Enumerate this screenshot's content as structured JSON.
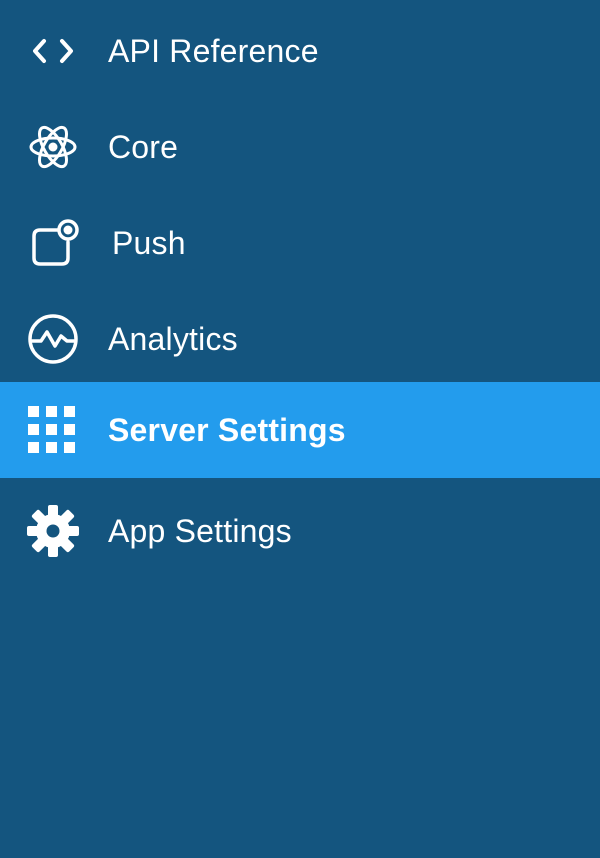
{
  "sidebar": {
    "background_color": "#14557f",
    "active_color": "#239ced",
    "active_index": 4,
    "items": [
      {
        "label": "API Reference",
        "icon": "code-brackets-icon"
      },
      {
        "label": "Core",
        "icon": "atom-icon"
      },
      {
        "label": "Push",
        "icon": "push-notification-icon"
      },
      {
        "label": "Analytics",
        "icon": "pulse-chart-icon"
      },
      {
        "label": "Server Settings",
        "icon": "grid-icon"
      },
      {
        "label": "App Settings",
        "icon": "gear-icon"
      }
    ]
  }
}
